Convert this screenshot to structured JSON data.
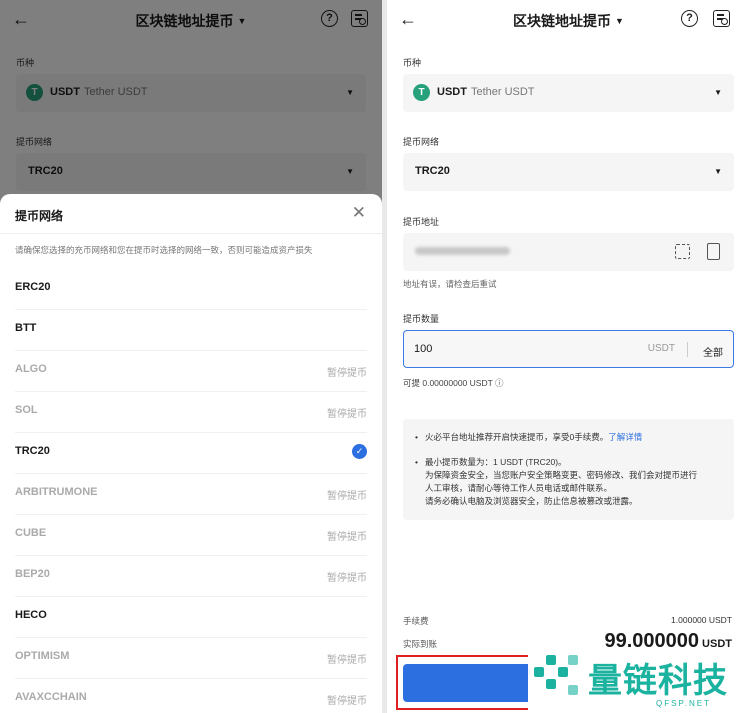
{
  "left": {
    "header": {
      "back_icon": "←",
      "title": "区块链地址提币",
      "caret": "▼",
      "help": "?"
    },
    "currency_label": "币种",
    "currency": {
      "symbol": "USDT",
      "name": "Tether USDT",
      "coin_icon": "T"
    },
    "network_label": "提币网络",
    "network_value": "TRC20",
    "dropdown_icon": "▼",
    "sheet": {
      "title": "提币网络",
      "close": "✕",
      "note": "请确保您选择的充币网络和您在提币时选择的网络一致，否则可能造成资产损失",
      "networks": [
        {
          "name": "ERC20",
          "status": ""
        },
        {
          "name": "BTT",
          "status": ""
        },
        {
          "name": "ALGO",
          "status": "暂停提币"
        },
        {
          "name": "SOL",
          "status": "暂停提币"
        },
        {
          "name": "TRC20",
          "status": "selected"
        },
        {
          "name": "ARBITRUMONE",
          "status": "暂停提币"
        },
        {
          "name": "CUBE",
          "status": "暂停提币"
        },
        {
          "name": "BEP20",
          "status": "暂停提币"
        },
        {
          "name": "HECO",
          "status": ""
        },
        {
          "name": "OPTIMISM",
          "status": "暂停提币"
        },
        {
          "name": "AVAXCCHAIN",
          "status": "暂停提币"
        }
      ]
    }
  },
  "right": {
    "header": {
      "back_icon": "←",
      "title": "区块链地址提币",
      "caret": "▼",
      "help": "?"
    },
    "currency_label": "币种",
    "currency": {
      "symbol": "USDT",
      "name": "Tether USDT",
      "coin_icon": "T"
    },
    "network_label": "提币网络",
    "network_value": "TRC20",
    "dropdown_icon": "▼",
    "address_label": "提币地址",
    "address_error": "地址有误，请检查后重试",
    "amount_label": "提币数量",
    "amount_value": "100",
    "amount_unit": "USDT",
    "all_button": "全部",
    "available": "可提  0.00000000 USDT ⓘ",
    "info": {
      "line1": "火必平台地址推荐开启快速提币，享受0手续费。",
      "line1_link": "了解详情",
      "line2": "最小提币数量为：1 USDT (TRC20)。",
      "line3": "为保障资金安全，当您账户安全策略变更、密码修改、我们会对提币进行",
      "line4": "人工审核，请耐心等待工作人员电话或邮件联系。",
      "line5": "请务必确认电脑及浏览器安全，防止信息被篡改或泄露。"
    },
    "fee_label": "手续费",
    "fee_value": "1.000000 USDT",
    "received_label": "实际到账",
    "received_value": "99.000000",
    "received_unit": "USDT"
  },
  "watermark": {
    "text": "量链科技",
    "sub": "QFSP.NET"
  },
  "colors": {
    "accent": "#2c6fe0",
    "tether": "#26a17b",
    "watermark": "#1bb3a0",
    "highlight": "#e02020"
  }
}
